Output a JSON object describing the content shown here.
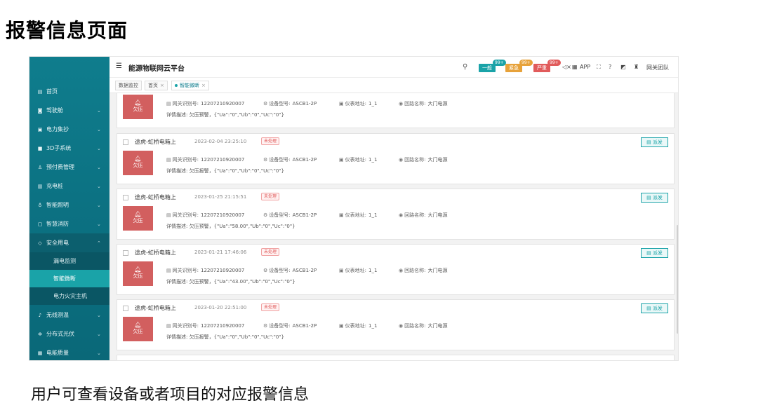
{
  "page": {
    "title": "报警信息页面",
    "caption": "用户可查看设备或者项目的对应报警信息"
  },
  "topbar": {
    "app_title": "能源物联网云平台",
    "levels": [
      {
        "label": "一般",
        "count": "99+",
        "color": "#1aa3a8"
      },
      {
        "label": "紧急",
        "count": "99+",
        "color": "#e7a23a"
      },
      {
        "label": "严重",
        "count": "99+",
        "color": "#e15b5b"
      }
    ],
    "app_label": "APP",
    "team_label": "网关团队"
  },
  "tabs": [
    {
      "label": "数据监控"
    },
    {
      "label": "首页"
    },
    {
      "label": "智能微断"
    }
  ],
  "sidebar": {
    "items": [
      {
        "label": "首页",
        "icon": "dashboard-icon"
      },
      {
        "label": "驾驶舱",
        "icon": "cockpit-icon"
      },
      {
        "label": "电力集抄",
        "icon": "meter-icon"
      },
      {
        "label": "3D子系统",
        "icon": "cube-icon"
      },
      {
        "label": "预付费管理",
        "icon": "user-icon"
      },
      {
        "label": "充电桩",
        "icon": "charger-icon"
      },
      {
        "label": "智能照明",
        "icon": "bulb-icon"
      },
      {
        "label": "智慧消防",
        "icon": "fire-icon"
      },
      {
        "label": "安全用电",
        "icon": "safety-icon"
      }
    ],
    "sub_items": [
      {
        "label": "漏电监测"
      },
      {
        "label": "智能微断"
      },
      {
        "label": "电力火灾主机"
      }
    ],
    "items_after": [
      {
        "label": "无线测温",
        "icon": "thermometer-icon"
      },
      {
        "label": "分布式光伏",
        "icon": "solar-icon"
      },
      {
        "label": "电能质量",
        "icon": "quality-icon"
      }
    ]
  },
  "labels": {
    "gateway_id": "网关识别号:",
    "model": "设备型号:",
    "meter_addr": "仪表地址:",
    "circuit": "回路名称:",
    "detail": "详情描述:",
    "dispatch": "派发",
    "alarm_type": "欠压",
    "status": "未处理"
  },
  "alarms": [
    {
      "name": "",
      "time": "",
      "gateway": "12207210920007",
      "model": "ASCB1-2P",
      "meter": "1_1",
      "circuit": "大门电源",
      "detail": "欠压预警，{\"Ua\":\"0\",\"Ub\":\"0\",\"Uc\":\"0\"}"
    },
    {
      "name": "途虎-虹桥电箱上",
      "time": "2023-02-04 23:25:10",
      "gateway": "12207210920007",
      "model": "ASCB1-2P",
      "meter": "1_1",
      "circuit": "大门电源",
      "detail": "欠压报警，{\"Ua\":\"0\",\"Ub\":\"0\",\"Uc\":\"0\"}"
    },
    {
      "name": "途虎-虹桥电箱上",
      "time": "2023-01-25 21:15:51",
      "gateway": "12207210920007",
      "model": "ASCB1-2P",
      "meter": "1_1",
      "circuit": "大门电源",
      "detail": "欠压预警，{\"Ua\":\"58.00\",\"Ub\":\"0\",\"Uc\":\"0\"}"
    },
    {
      "name": "途虎-虹桥电箱上",
      "time": "2023-01-21 17:46:06",
      "gateway": "12207210920007",
      "model": "ASCB1-2P",
      "meter": "1_1",
      "circuit": "大门电源",
      "detail": "欠压预警，{\"Ua\":\"43.00\",\"Ub\":\"0\",\"Uc\":\"0\"}"
    },
    {
      "name": "途虎-虹桥电箱上",
      "time": "2023-01-20 22:51:00",
      "gateway": "12207210920007",
      "model": "ASCB1-2P",
      "meter": "1_1",
      "circuit": "大门电源",
      "detail": "欠压报警，{\"Ua\":\"0\",\"Ub\":\"0\",\"Uc\":\"0\"}"
    }
  ]
}
